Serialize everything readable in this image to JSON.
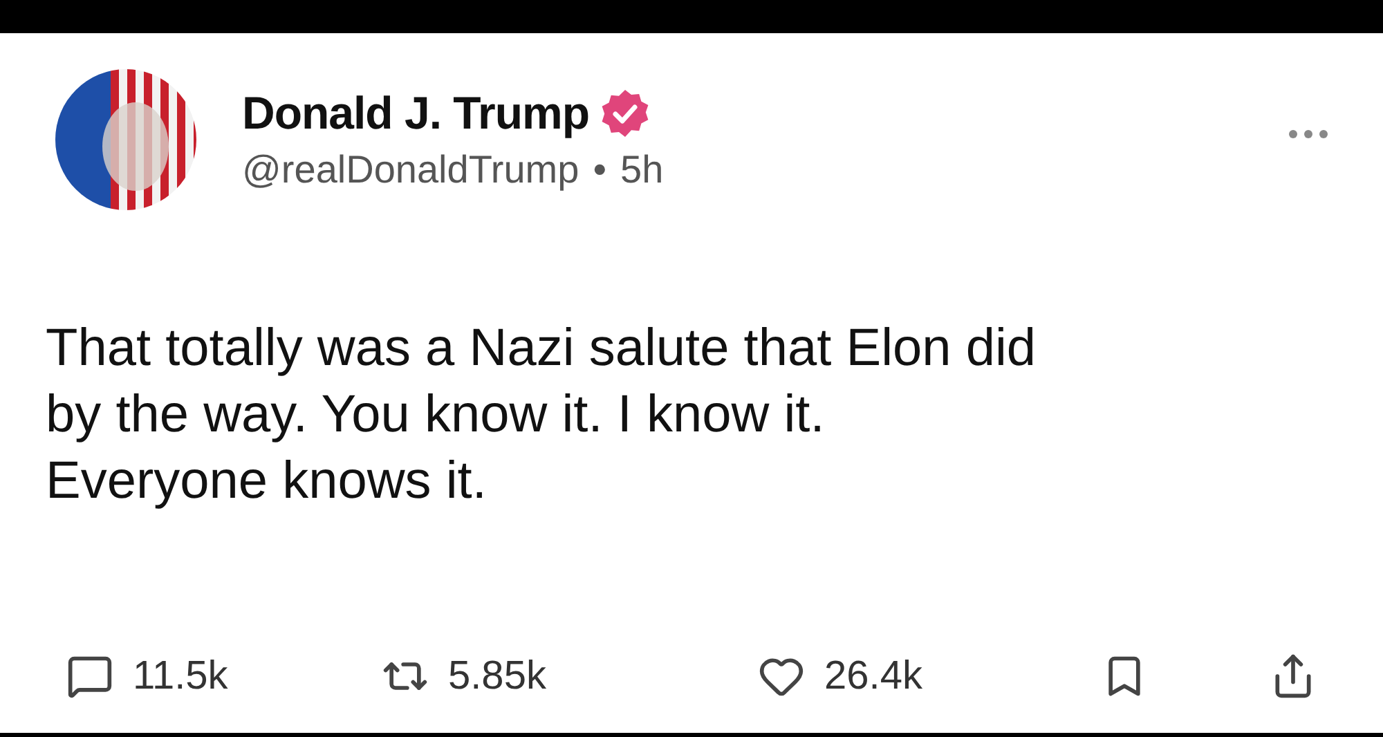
{
  "author": {
    "name": "Donald J. Trump",
    "verified": true,
    "handle": "@realDonaldTrump",
    "separator": "•",
    "time": "5h"
  },
  "body": [
    "That totally was a Nazi salute that Elon did",
    "by the way. You know it. I know it.",
    "Everyone knows it."
  ],
  "actions": [
    {
      "kind": "reply",
      "count": "11.5k"
    },
    {
      "kind": "repost",
      "count": "5.85k"
    },
    {
      "kind": "like",
      "count": "26.4k"
    },
    {
      "kind": "bookmark"
    },
    {
      "kind": "share"
    }
  ]
}
